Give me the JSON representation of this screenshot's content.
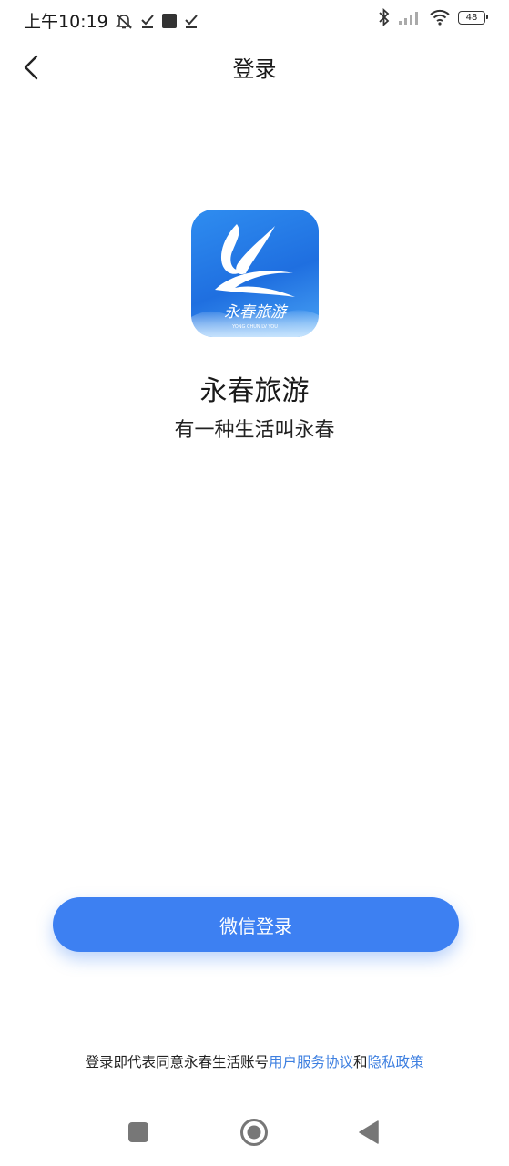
{
  "status_bar": {
    "time": "上午10:19",
    "battery_level": "48",
    "icons": [
      "mute-icon",
      "check-icon",
      "square-icon",
      "check-icon",
      "bluetooth-icon",
      "signal-icon",
      "wifi-icon",
      "battery-icon"
    ]
  },
  "nav": {
    "title": "登录"
  },
  "branding": {
    "app_name": "永春旅游",
    "slogan": "有一种生活叫永春",
    "logo_text": "永春旅游",
    "logo_subtext": "YONG CHUN LV YOU"
  },
  "login": {
    "wechat_button_label": "微信登录"
  },
  "agreement": {
    "prefix": "登录即代表同意永春生活账号",
    "terms_link": "用户服务协议",
    "conjunction": "和",
    "privacy_link": "隐私政策"
  },
  "colors": {
    "primary": "#3d80f2",
    "link": "#3d7fe0",
    "logo_blue": "#1f6fe0"
  }
}
